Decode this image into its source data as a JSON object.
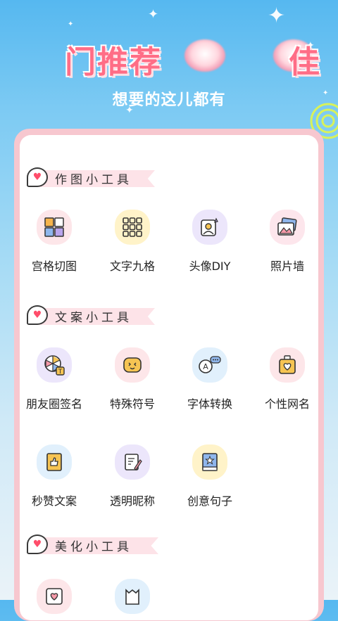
{
  "banner": {
    "title": "门推荐 好 佳",
    "title_visible": "门推荐",
    "title_tail": "佳",
    "subtitle": "想要的这儿都有"
  },
  "sections": [
    {
      "title": "作图小工具",
      "tools": [
        {
          "label": "宫格切图",
          "icon": "grid-cut-icon",
          "bg": "#fde6e9"
        },
        {
          "label": "文字九格",
          "icon": "text-nine-grid-icon",
          "bg": "#fff3c9"
        },
        {
          "label": "头像DIY",
          "icon": "avatar-diy-icon",
          "bg": "#ece6fb"
        },
        {
          "label": "照片墙",
          "icon": "photo-wall-icon",
          "bg": "#fde6ec"
        }
      ]
    },
    {
      "title": "文案小工具",
      "tools": [
        {
          "label": "朋友圈签名",
          "icon": "moments-signature-icon",
          "bg": "#ece6fb"
        },
        {
          "label": "特殊符号",
          "icon": "special-symbol-icon",
          "bg": "#fde6e9"
        },
        {
          "label": "字体转换",
          "icon": "font-convert-icon",
          "bg": "#e1f0fc"
        },
        {
          "label": "个性网名",
          "icon": "nickname-badge-icon",
          "bg": "#fde6e9"
        },
        {
          "label": "秒赞文案",
          "icon": "like-copy-icon",
          "bg": "#e1f0fc"
        },
        {
          "label": "透明昵称",
          "icon": "transparent-nickname-icon",
          "bg": "#ece6fb"
        },
        {
          "label": "创意句子",
          "icon": "creative-sentence-icon",
          "bg": "#fff3c9"
        }
      ]
    },
    {
      "title": "美化小工具",
      "tools": [
        {
          "label": "",
          "icon": "beautify-heart-icon",
          "bg": "#fde6e9"
        },
        {
          "label": "",
          "icon": "beautify-frame-icon",
          "bg": "#e1f0fc"
        }
      ]
    }
  ],
  "colors": {
    "accent_pink": "#ff6d86",
    "card_border": "#f7c7cf",
    "ribbon": "#fde3e8"
  }
}
